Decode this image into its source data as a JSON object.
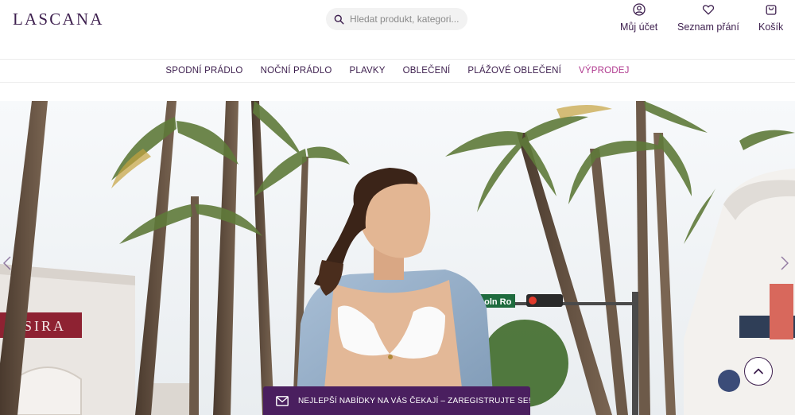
{
  "brand": {
    "logo": "LASCANA"
  },
  "search": {
    "placeholder": "Hledat produkt, kategori..."
  },
  "header_actions": [
    {
      "id": "account",
      "label": "Můj účet",
      "icon": "user-circle-icon"
    },
    {
      "id": "wishlist",
      "label": "Seznam přání",
      "icon": "heart-icon"
    },
    {
      "id": "cart",
      "label": "Košík",
      "icon": "shopping-bag-icon"
    }
  ],
  "nav": {
    "items": [
      {
        "label": "SPODNÍ PRÁDLO"
      },
      {
        "label": "NOČNÍ PRÁDLO"
      },
      {
        "label": "PLAVKY"
      },
      {
        "label": "OBLEČENÍ"
      },
      {
        "label": "PLÁŽOVÉ OBLEČENÍ"
      },
      {
        "label": "VÝPRODEJ"
      }
    ]
  },
  "hero": {
    "street_sign": "coln Ro",
    "storefront_sign": "SIRA",
    "prev_icon": "chevron-left-icon",
    "next_icon": "chevron-right-icon"
  },
  "promo_bar": {
    "text": "NEJLEPŠÍ NABÍDKY NA VÁS ČEKAJÍ – ZAREGISTRUJTE SE!",
    "icon": "mail-icon"
  },
  "colors": {
    "brand": "#3d1f4e",
    "sale": "#b03a8f",
    "promo_bg": "#4a1f5f"
  }
}
